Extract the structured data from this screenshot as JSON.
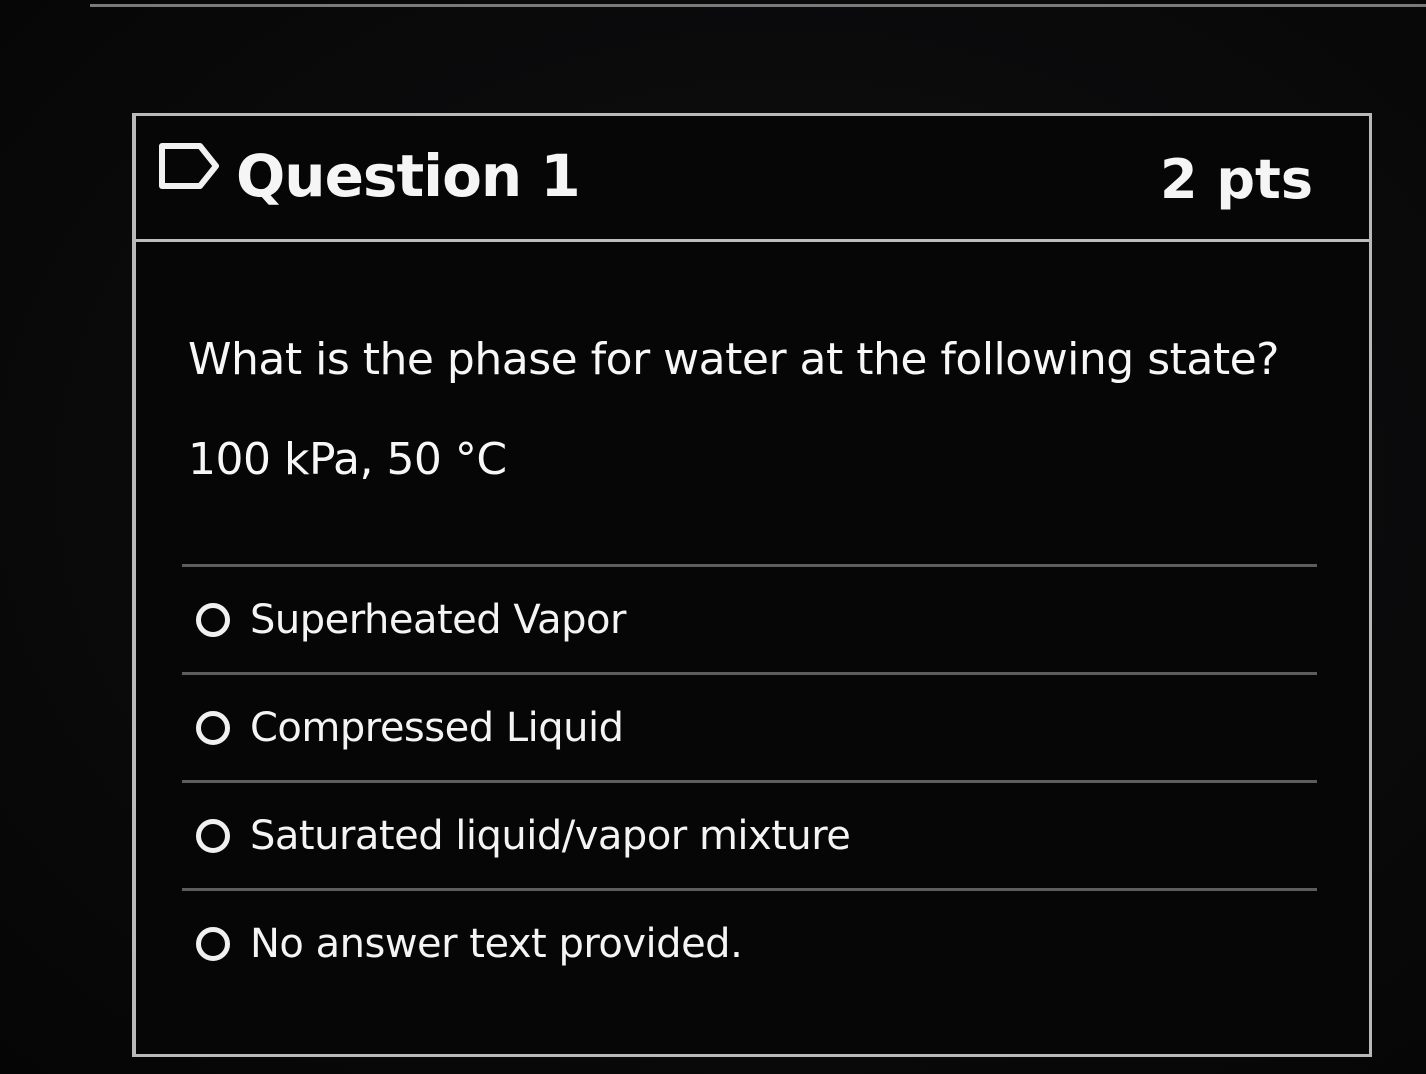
{
  "question": {
    "title": "Question 1",
    "points": "2 pts",
    "flag_icon": "flag-outline-icon",
    "text": "What is the phase for water at the following state?",
    "state": "100 kPa, 50 °C",
    "answers": [
      {
        "label": "Superheated Vapor",
        "selected": false
      },
      {
        "label": "Compressed Liquid",
        "selected": false
      },
      {
        "label": "Saturated liquid/vapor mixture",
        "selected": false
      },
      {
        "label": "No answer text provided.",
        "selected": false
      }
    ]
  },
  "colors": {
    "background": "#0b0b0c",
    "card_border": "#b9b9b9",
    "text": "#f2f2f2",
    "divider": "#5d5d5d"
  }
}
